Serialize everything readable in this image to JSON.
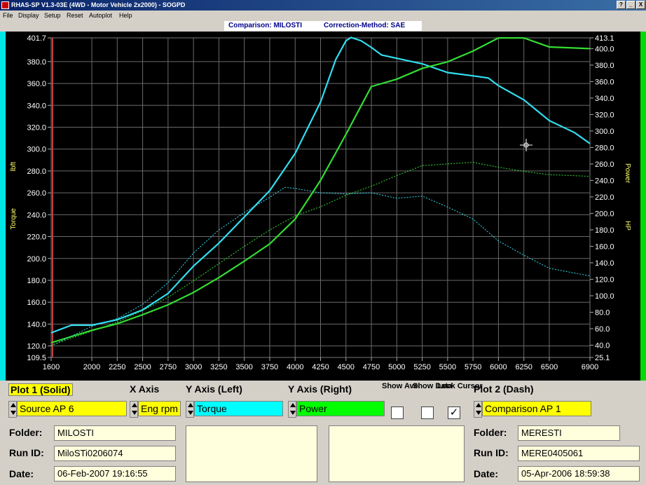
{
  "window": {
    "title": "RHAS-SP V1.3-03E  (4WD - Motor Vehicle 2x2000) - SOGPD",
    "buttons": [
      "?",
      "_",
      "X"
    ]
  },
  "menu": [
    "File",
    "Display",
    "Setup",
    "Reset",
    "Autoplot",
    "Help"
  ],
  "comparison": {
    "label": "Comparison: MILOSTI",
    "correction": "Correction-Method: SAE"
  },
  "colors": {
    "plot_background": "#000000",
    "torque_line": "#33ddf0",
    "power_line": "#33dd33",
    "left_axis_bar": "#00e5e5",
    "right_axis_bar": "#00dd00",
    "field_yellow": "#ffff00",
    "field_cyan": "#00ffff",
    "field_green": "#00ff00"
  },
  "chart_data": {
    "type": "line",
    "x_ticks": [
      "1600",
      "2000",
      "2250",
      "2500",
      "2750",
      "3000",
      "3250",
      "3500",
      "3750",
      "4000",
      "4250",
      "4500",
      "4750",
      "5000",
      "5250",
      "5500",
      "5750",
      "6000",
      "6250",
      "6500",
      "6900"
    ],
    "left_ticks": [
      "401.7",
      "380.0",
      "360.0",
      "340.0",
      "320.0",
      "300.0",
      "280.0",
      "260.0",
      "240.0",
      "220.0",
      "200.0",
      "180.0",
      "160.0",
      "140.0",
      "120.0",
      "109.5"
    ],
    "right_ticks": [
      "413.1",
      "400.0",
      "380.0",
      "360.0",
      "340.0",
      "320.0",
      "300.0",
      "280.0",
      "260.0",
      "240.0",
      "220.0",
      "200.0",
      "180.0",
      "160.0",
      "140.0",
      "120.0",
      "100.0",
      "80.0",
      "60.0",
      "40.0",
      "25.1"
    ],
    "xlim": [
      1600,
      6900
    ],
    "ylim_left": [
      109.5,
      401.7
    ],
    "ylim_right": [
      25.1,
      413.1
    ],
    "left_axis": {
      "unit": "lbft",
      "name": "Torque"
    },
    "right_axis": {
      "unit": "HP",
      "name": "Power"
    },
    "grid": true,
    "series": [
      {
        "style": "solid",
        "axis": "left",
        "color": "#33ddf0",
        "x": [
          1600,
          1800,
          2000,
          2250,
          2500,
          2750,
          3000,
          3250,
          3500,
          3750,
          4000,
          4250,
          4400,
          4500,
          4550,
          4650,
          4750,
          4850,
          5000,
          5250,
          5500,
          5750,
          5900,
          6000,
          6250,
          6500,
          6750,
          6900
        ],
        "y": [
          132,
          139,
          139,
          144,
          153,
          168,
          193,
          214,
          238,
          262,
          296,
          343,
          382,
          399,
          402,
          399,
          393,
          386,
          383,
          378,
          370,
          367,
          365,
          358,
          345,
          326,
          315,
          305
        ]
      },
      {
        "style": "solid",
        "axis": "right",
        "color": "#33dd33",
        "x": [
          1600,
          2000,
          2250,
          2500,
          2750,
          3000,
          3250,
          3500,
          3750,
          4000,
          4250,
          4500,
          4750,
          5000,
          5250,
          5500,
          5750,
          6000,
          6250,
          6500,
          6900
        ],
        "y": [
          43,
          58,
          66,
          77,
          89,
          104,
          122,
          142,
          163,
          193,
          240,
          296,
          354,
          363,
          376,
          384,
          397,
          413,
          413,
          402,
          400
        ]
      },
      {
        "style": "dash",
        "axis": "left",
        "color": "#33ddf0",
        "x": [
          1600,
          2000,
          2250,
          2500,
          2750,
          3000,
          3250,
          3500,
          3750,
          3900,
          4000,
          4250,
          4500,
          4750,
          5000,
          5250,
          5500,
          5750,
          6000,
          6250,
          6500,
          6900
        ],
        "y": [
          120,
          138,
          145,
          158,
          178,
          205,
          226,
          242,
          256,
          265,
          264,
          260,
          259,
          260,
          255,
          257,
          247,
          236,
          216,
          203,
          191,
          184
        ]
      },
      {
        "style": "dash",
        "axis": "right",
        "color": "#33dd33",
        "x": [
          1600,
          2000,
          2250,
          2500,
          2750,
          3000,
          3250,
          3500,
          3750,
          4000,
          4250,
          4500,
          4750,
          5000,
          5250,
          5500,
          5750,
          6000,
          6250,
          6500,
          6900
        ],
        "y": [
          40,
          57,
          68,
          82,
          98,
          118,
          139,
          160,
          180,
          197,
          208,
          222,
          233,
          246,
          258,
          260,
          262,
          256,
          251,
          247,
          245
        ]
      }
    ]
  },
  "controls": {
    "plot1_title": "Plot 1 (Solid)",
    "xaxis_title": "X Axis",
    "yleft_title": "Y Axis (Left)",
    "yright_title": "Y Axis (Right)",
    "show_ave_label": "Show Ave.",
    "show_data_label": "Show Data",
    "lock_cursor_label": "Lock Cursor",
    "plot2_title": "Plot 2 (Dash)",
    "plot1_source": "Source AP 6",
    "xaxis_value": "Eng rpm",
    "yleft_value": "Torque",
    "yright_value": "Power",
    "plot2_source": "Comparison AP 1",
    "show_ave_checked": false,
    "show_data_checked": false,
    "lock_cursor_checked": true,
    "check_mark": "✓"
  },
  "plot1": {
    "folder_label": "Folder:",
    "folder": "MILOSTI",
    "runid_label": "Run ID:",
    "runid": "MiloSTi0206074",
    "date_label": "Date:",
    "date": "06-Feb-2007  19:16:55"
  },
  "plot2": {
    "folder_label": "Folder:",
    "folder": "MERESTI",
    "runid_label": "Run ID:",
    "runid": "MERE0405061",
    "date_label": "Date:",
    "date": "05-Apr-2006  18:59:38"
  }
}
